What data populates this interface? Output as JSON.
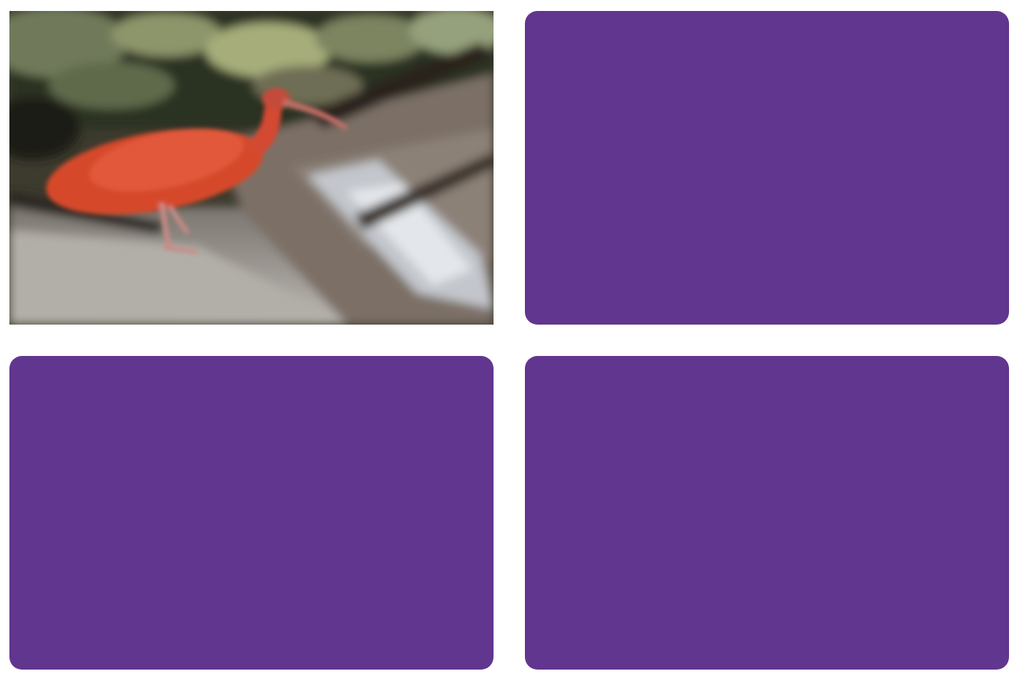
{
  "game": {
    "type": "memory-match",
    "card_back_color": "#61368f",
    "cards": [
      {
        "state": "face-up",
        "image": "scarlet-ibis"
      },
      {
        "state": "face-down"
      },
      {
        "state": "face-down"
      },
      {
        "state": "face-down"
      }
    ]
  }
}
